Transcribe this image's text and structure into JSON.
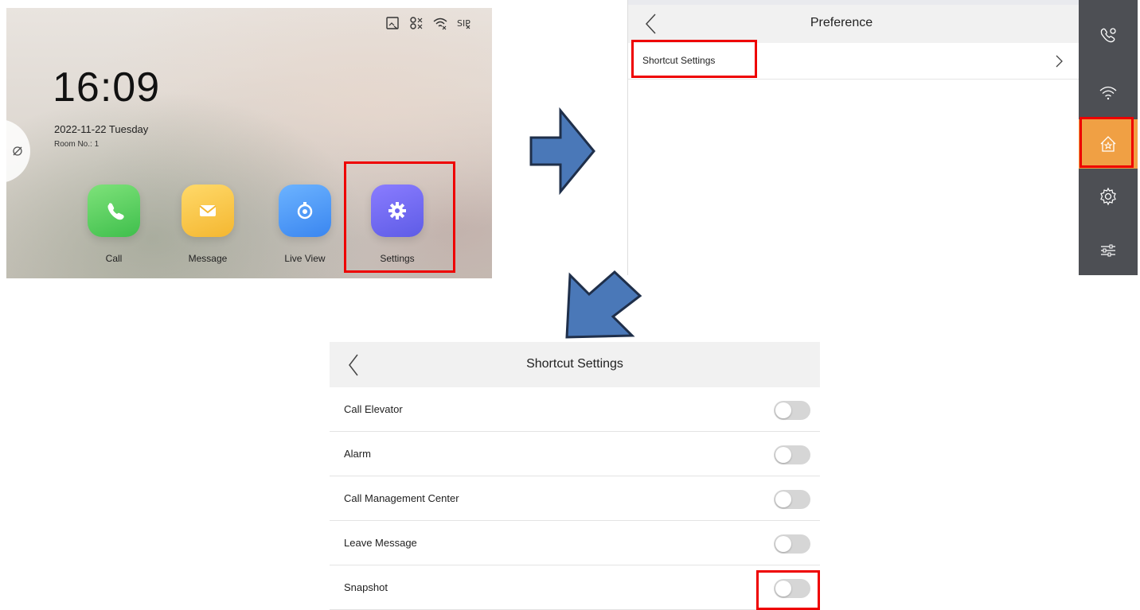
{
  "home": {
    "clock": "16:09",
    "date": "2022-11-22  Tuesday",
    "room": "Room No.: 1",
    "status_icons": [
      "sd-card-icon",
      "link-off-icon",
      "wifi-off-icon",
      "sip-icon"
    ],
    "apps": [
      {
        "label": "Call",
        "icon": "phone-icon",
        "color": "#4cc55a"
      },
      {
        "label": "Message",
        "icon": "envelope-icon",
        "color": "#f6bf3b"
      },
      {
        "label": "Live View",
        "icon": "camera-icon",
        "color": "#4a92f4"
      },
      {
        "label": "Settings",
        "icon": "gear-icon",
        "color": "#6b63ee"
      }
    ]
  },
  "preference": {
    "title": "Preference",
    "rows": [
      {
        "label": "Shortcut Settings"
      }
    ],
    "sidebar_icons": [
      "call-settings-icon",
      "wifi-icon",
      "home-star-icon",
      "gear-icon",
      "sliders-icon"
    ],
    "active_sidebar_index": 2,
    "accent_color": "#f0a044"
  },
  "shortcut_settings": {
    "title": "Shortcut Settings",
    "rows": [
      {
        "label": "Call Elevator",
        "enabled": false
      },
      {
        "label": "Alarm",
        "enabled": false
      },
      {
        "label": "Call Management Center",
        "enabled": false
      },
      {
        "label": "Leave Message",
        "enabled": false
      },
      {
        "label": "Snapshot",
        "enabled": false
      }
    ]
  },
  "highlight_color": "#e00000",
  "arrow_color": "#4a78b8"
}
